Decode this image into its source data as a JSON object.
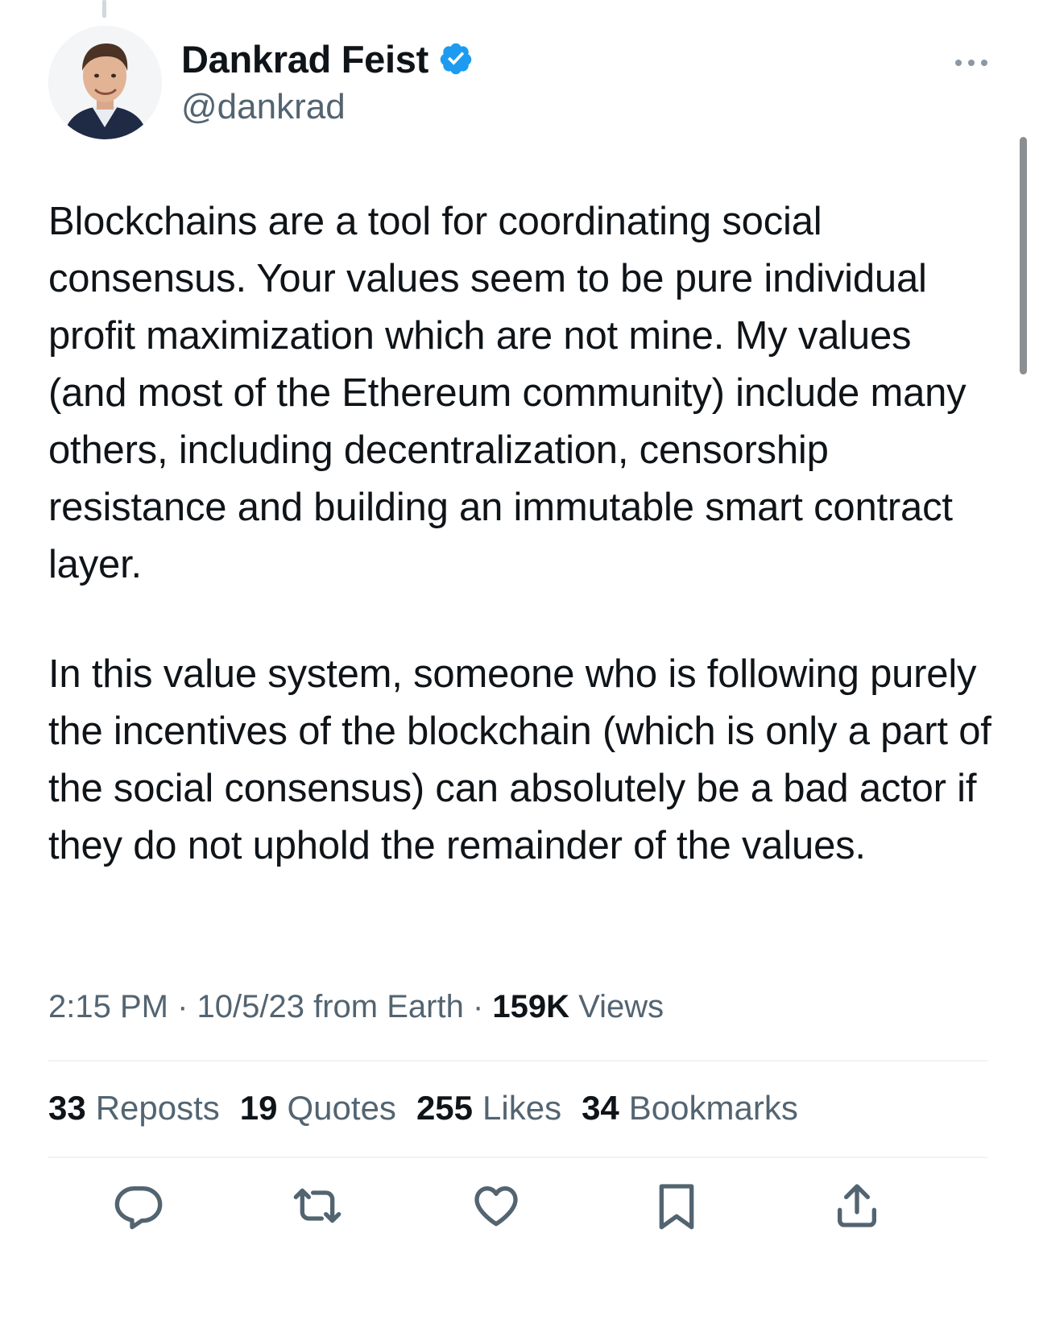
{
  "author": {
    "display_name": "Dankrad Feist",
    "handle": "@dankrad",
    "verified": true,
    "avatar_icon": "profile-photo"
  },
  "tweet": {
    "paragraph1": "Blockchains are a tool for coordinating social consensus. Your values seem to be pure individual profit maximization which are not mine. My values (and most of the Ethereum community) include many others, including decentralization, censorship resistance and building an immutable smart contract layer.",
    "paragraph2": "In this value system, someone who is following purely the incentives of the blockchain (which is only a part of the social consensus) can absolutely be a bad actor if they do not uphold the remainder of the values."
  },
  "meta": {
    "time": "2:15 PM",
    "sep1": " · ",
    "date": "10/5/23",
    "source": " from Earth",
    "sep2": " · ",
    "views_count": "159K",
    "views_label": " Views"
  },
  "stats": {
    "reposts": {
      "count": "33",
      "label": "Reposts"
    },
    "quotes": {
      "count": "19",
      "label": "Quotes"
    },
    "likes": {
      "count": "255",
      "label": "Likes"
    },
    "bookmarks": {
      "count": "34",
      "label": "Bookmarks"
    }
  },
  "actions": [
    "reply-icon",
    "repost-icon",
    "like-icon",
    "bookmark-icon",
    "share-icon"
  ],
  "colors": {
    "text": "#0f1419",
    "secondary": "#536471",
    "verified": "#1d9bf0",
    "divider": "#eff3f4"
  }
}
